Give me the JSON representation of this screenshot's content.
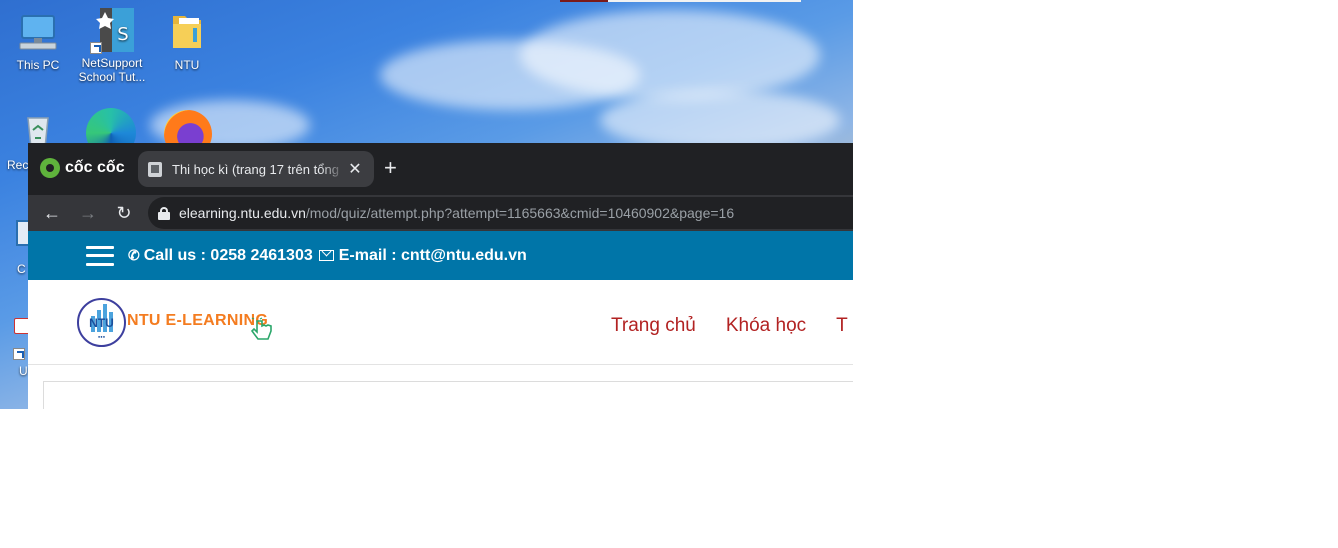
{
  "desktop": {
    "icons": [
      {
        "label": "This PC"
      },
      {
        "label": "NetSupport School Tut..."
      },
      {
        "label": "NTU"
      },
      {
        "label": "Rec"
      },
      {
        "label": "C"
      },
      {
        "label": "U"
      }
    ]
  },
  "browser": {
    "brand": "cốc cốc",
    "tab": {
      "title": "Thi học kì (trang 17 trên tổng",
      "close": "✕"
    },
    "new_tab": "+",
    "nav": {
      "back": "←",
      "forward": "→",
      "reload": "↻"
    },
    "address": {
      "host": "elearning.ntu.edu.vn",
      "path": "/mod/quiz/attempt.php?attempt=1165663&cmid=10460902&page=16"
    }
  },
  "site": {
    "infobar": {
      "call": "Call us : 0258 2461303",
      "email": "E-mail : cntt@ntu.edu.vn"
    },
    "logo": {
      "text": "NTU",
      "brand": "NTU E-LEARNING"
    },
    "nav": [
      {
        "label": "Trang chủ"
      },
      {
        "label": "Khóa học"
      },
      {
        "label": "T"
      }
    ]
  },
  "colors": {
    "infobar": "#0075a8",
    "brand": "#f47c20",
    "nav_link": "#b22222"
  }
}
